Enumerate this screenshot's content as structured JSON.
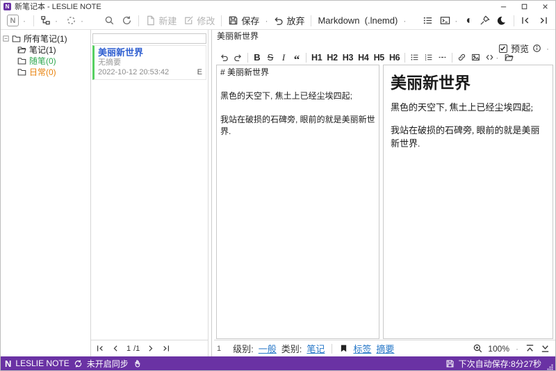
{
  "window": {
    "title": "新笔记本 - LESLIE NOTE"
  },
  "icons": {
    "dot": "·",
    "contrast": "◐",
    "quote": "“",
    "n_letter": "N"
  },
  "toolbar": {
    "new_label": "新建",
    "edit_label": "修改",
    "save_label": "保存",
    "discard_label": "放弃",
    "format_selector": "Markdown  (.lnemd)"
  },
  "sidebar": {
    "items": [
      {
        "label": "所有笔记(1)",
        "color": "#1c1c1c"
      },
      {
        "label": "笔记(1)",
        "color": "#1c1c1c"
      },
      {
        "label": "随笔(0)",
        "color": "#2fa84f"
      },
      {
        "label": "日常(0)",
        "color": "#e8820c"
      }
    ]
  },
  "notelist": {
    "search_value": "",
    "note": {
      "title": "美丽新世界",
      "summary": "无摘要",
      "date": "2022-10-12 20:53:42",
      "badge": "E"
    },
    "pagination": {
      "current": "1",
      "total": "/1"
    }
  },
  "editor": {
    "note_title": "美丽新世界",
    "preview_label": "预览",
    "toolbar": {
      "bold": "B",
      "strikethrough": "S",
      "italic": "I",
      "headings": [
        "H1",
        "H2",
        "H3",
        "H4",
        "H5",
        "H6"
      ]
    },
    "source_text": "# 美丽新世界\n\n黑色的天空下, 焦土上已经尘埃四起;\n\n我站在破损的石碑旁, 眼前的就是美丽新世界.",
    "preview": {
      "heading": "美丽新世界",
      "paragraphs": [
        "黑色的天空下, 焦土上已经尘埃四起;",
        "我站在破损的石碑旁, 眼前的就是美丽新世界."
      ]
    },
    "cursor_line": "1"
  },
  "meta_bar": {
    "level_label": "级别:",
    "level_value": "一般",
    "category_label": "类别:",
    "category_value": "笔记",
    "tags_label": "标签",
    "summary_label": "摘要",
    "zoom": "100%"
  },
  "statusbar": {
    "app_name": "LESLIE NOTE",
    "sync_status": "未开启同步",
    "autosave": "下次自动保存:8分27秒"
  },
  "colors": {
    "accent_purple": "#6a32a4",
    "note_title_blue": "#2f5fd0",
    "link_blue": "#2878c8",
    "folder_green": "#2fa84f",
    "folder_orange": "#e8820c",
    "card_bar_green": "#57d061"
  }
}
